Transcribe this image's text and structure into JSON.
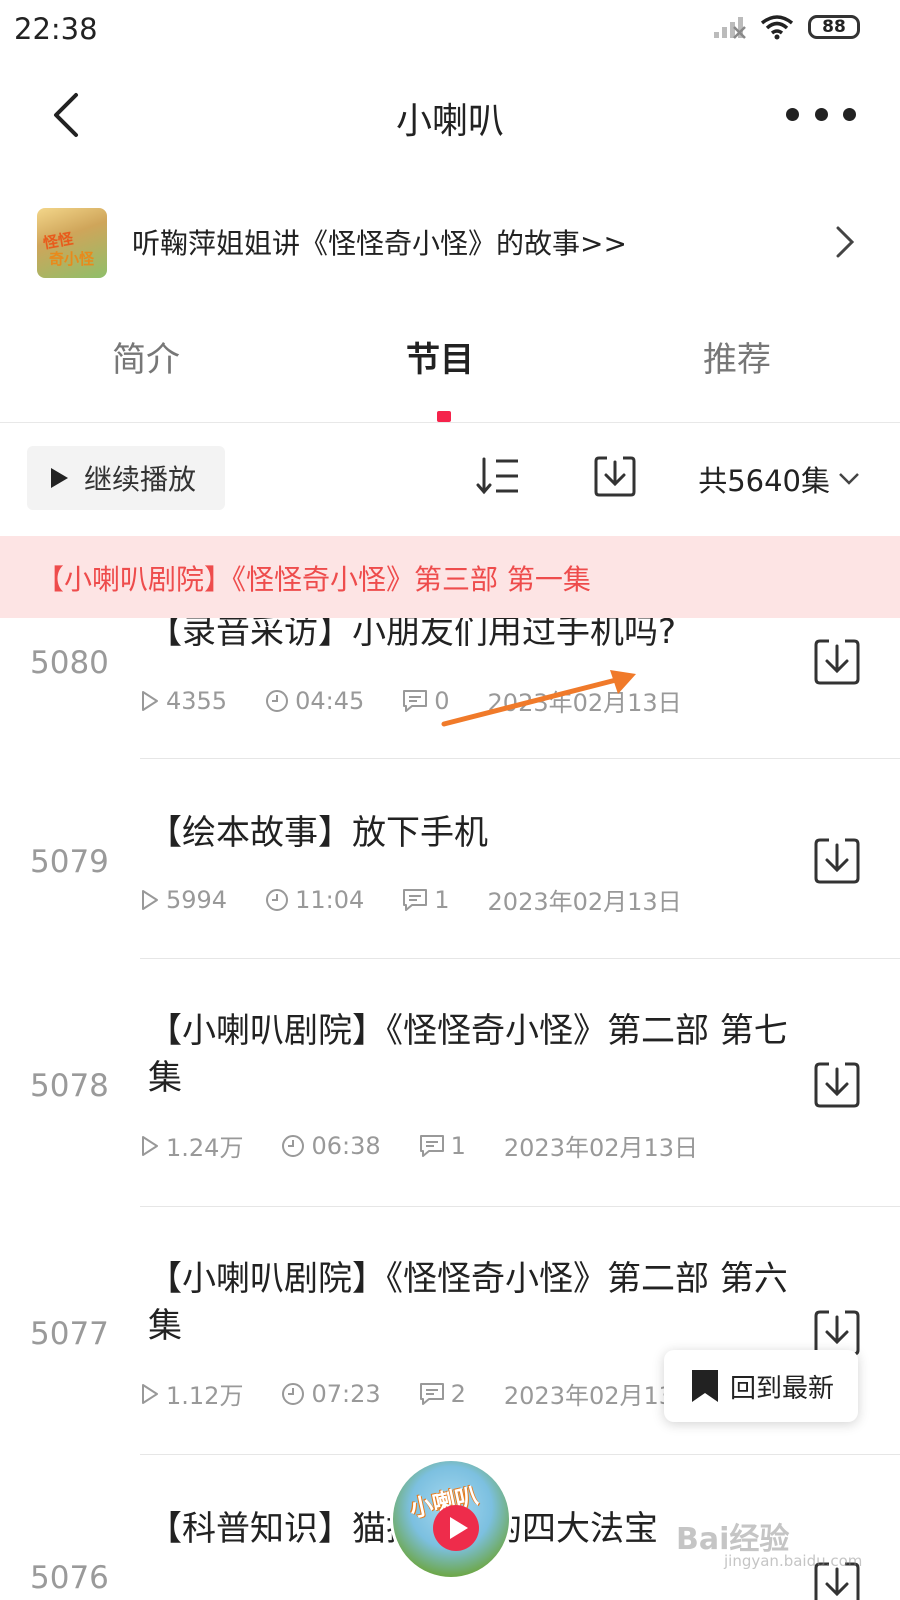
{
  "status_bar": {
    "time": "22:38",
    "battery": "88"
  },
  "nav": {
    "title": "小喇叭"
  },
  "promo": {
    "text": "听鞠萍姐姐讲《怪怪奇小怪》的故事>>",
    "cover_text_1": "怪怪",
    "cover_text_2": "奇小怪"
  },
  "tabs": [
    {
      "label": "简介"
    },
    {
      "label": "节目",
      "active": true
    },
    {
      "label": "推荐"
    }
  ],
  "toolbar": {
    "continue_label": "继续播放",
    "episode_count": "共5640集"
  },
  "banner": {
    "text": "【小喇叭剧院】《怪怪奇小怪》第三部 第一集"
  },
  "episodes": [
    {
      "number": "5080",
      "title": "【录音采访】小朋友们用过手机吗?",
      "plays": "4355",
      "duration": "04:45",
      "comments": "0",
      "date": "2023年02月13日"
    },
    {
      "number": "5079",
      "title": "【绘本故事】放下手机",
      "plays": "5994",
      "duration": "11:04",
      "comments": "1",
      "date": "2023年02月13日"
    },
    {
      "number": "5078",
      "title": "【小喇叭剧院】《怪怪奇小怪》第二部 第七集",
      "plays": "1.24万",
      "duration": "06:38",
      "comments": "1",
      "date": "2023年02月13日"
    },
    {
      "number": "5077",
      "title": "【小喇叭剧院】《怪怪奇小怪》第二部 第六集",
      "plays": "1.12万",
      "duration": "07:23",
      "comments": "2",
      "date": "2023年02月13日"
    },
    {
      "number": "5076",
      "title": "【科普知识】猫抓老鼠的四大法宝",
      "plays": "",
      "duration": "",
      "comments": "",
      "date": ""
    }
  ],
  "back_to_latest": {
    "label": "回到最新"
  },
  "mini_player": {
    "logo_text": "小喇叭"
  },
  "watermark": {
    "text": "Bai经验",
    "sub": "jingyan.baidu.com"
  },
  "colors": {
    "accent": "#f5234b",
    "banner_bg": "#fde4e4",
    "banner_text": "#ee4c4c",
    "annotation": "#f07a2a"
  },
  "icons": [
    "back-icon",
    "more-icon",
    "chevron-right-icon",
    "play-icon",
    "sort-icon",
    "download-icon",
    "chevron-down-icon",
    "clock-icon",
    "comment-icon",
    "bookmark-icon"
  ]
}
